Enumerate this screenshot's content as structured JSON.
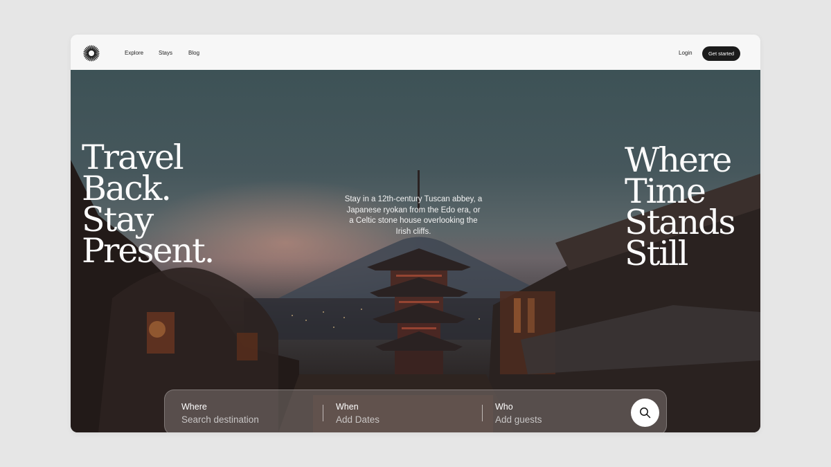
{
  "nav": {
    "links": [
      "Explore",
      "Stays",
      "Blog"
    ],
    "login": "Login",
    "cta": "Get started"
  },
  "hero": {
    "headline_left": [
      "Travel",
      "Back.",
      "Stay",
      "Present."
    ],
    "headline_right": [
      "Where",
      "Time",
      "Stands",
      "Still"
    ],
    "tagline": "Stay in a 12th-century Tuscan abbey, a Japanese ryokan from the Edo era, or a Celtic stone house overlooking the Irish cliffs."
  },
  "search": {
    "where": {
      "label": "Where",
      "placeholder": "Search destination"
    },
    "when": {
      "label": "When",
      "placeholder": "Add Dates"
    },
    "who": {
      "label": "Who",
      "placeholder": "Add guests"
    },
    "button_icon": "search-icon"
  },
  "icons": {
    "logo": "sunburst-logo-icon",
    "search": "search-icon"
  },
  "colors": {
    "page_background": "#e6e6e6",
    "navbar_background": "#f7f7f7",
    "cta_background": "#1b1b1b",
    "headline_text": "#fbfbfb"
  }
}
